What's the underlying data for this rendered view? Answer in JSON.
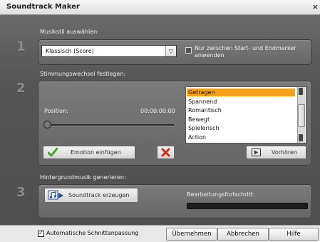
{
  "window": {
    "title": "Soundtrack Maker",
    "close_glyph": "×"
  },
  "step1": {
    "number": "1",
    "label": "Musikstil auswählen:",
    "style_select": {
      "value": "Klassisch (Score)",
      "arrow_glyph": "▽"
    },
    "range_checkbox": {
      "checked": false,
      "label_line1": "Nur zwischen Start- und Endmarker",
      "label_line2": "anwenden"
    }
  },
  "step2": {
    "number": "2",
    "label": "Stimmungswechsel festlegen:",
    "position_label": "Position:",
    "position_time": "00:00:00:00",
    "position_slider_fraction": 0.0,
    "emotions": [
      "Getragen",
      "Spannend",
      "Romantisch",
      "Bewegt",
      "Spielerisch",
      "Action"
    ],
    "selected_emotion_index": 0,
    "insert_button": {
      "label": "Emotion einfügen",
      "icon": "checkmark-icon",
      "icon_color": "#3fa82a"
    },
    "delete_button": {
      "icon": "delete-x-icon",
      "icon_color": "#d0281c"
    },
    "preview_button": {
      "label": "Vorhören",
      "icon": "play-icon"
    }
  },
  "step3": {
    "number": "3",
    "label": "Hintergrundmusik generieren:",
    "generate_button": {
      "label": "Soundtrack erzeugen",
      "icon": "soundtrack-icon"
    },
    "progress_label": "Bearbeitungsfortschritt:",
    "progress_fraction": 0.0
  },
  "footer": {
    "auto_cut_checkbox": {
      "checked": true,
      "label": "Automatische Schnittanpassung"
    },
    "apply_label": "Übernehmen",
    "cancel_label": "Abbrechen",
    "help_label": "Hilfe"
  },
  "colors": {
    "selection": "#f4a21c",
    "panel": "#707070"
  }
}
